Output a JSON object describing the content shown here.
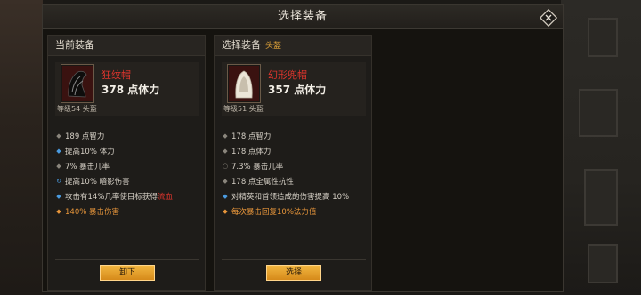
{
  "window": {
    "title": "选择装备"
  },
  "current": {
    "header": "当前装备",
    "item_name": "狂纹帽",
    "item_stat": "378 点体力",
    "item_level": "等级54 头盔",
    "stats": [
      {
        "bullet": "gray",
        "text": "189 点智力"
      },
      {
        "bullet": "blue",
        "text": "提高10% 体力"
      },
      {
        "bullet": "gray",
        "text": "7% 暴击几率"
      },
      {
        "bullet": "cycle",
        "text": "提高10% 暗影伤害"
      },
      {
        "bullet": "blue",
        "text": "攻击有14%几率使目标获得",
        "highlight": "流血"
      },
      {
        "bullet": "orange",
        "text": "140% 暴击伤害"
      }
    ],
    "button": "卸下"
  },
  "select": {
    "header": "选择装备",
    "slot": "头盔",
    "item_name": "幻形兜帽",
    "item_stat": "357 点体力",
    "item_level": "等级51 头盔",
    "stats": [
      {
        "bullet": "gray",
        "text": "178 点智力"
      },
      {
        "bullet": "gray",
        "text": "178 点体力"
      },
      {
        "bullet": "ring",
        "text": "7.3% 暴击几率"
      },
      {
        "bullet": "gray",
        "text": "178 点全属性抗性"
      },
      {
        "bullet": "blue",
        "text": "对精英和首领造成的伤害提高 10%"
      },
      {
        "bullet": "orange",
        "text": "每次暴击回复10%法力值"
      }
    ],
    "button": "选择"
  },
  "colors": {
    "accent": "#e7a83a",
    "item_name": "#e0352d",
    "legendary": "#e7953a"
  }
}
